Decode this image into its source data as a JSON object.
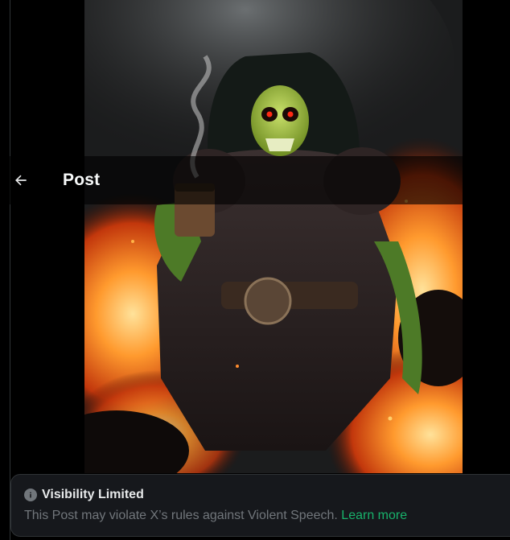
{
  "header": {
    "title": "Post",
    "back_icon": "arrow-left-icon"
  },
  "media": {
    "alt_subject": "skull-faced warrior holding coffee cup amid flames"
  },
  "notice": {
    "icon": "info-icon",
    "title": "Visibility Limited",
    "body": "This Post may violate X’s rules against Violent Speech.",
    "link_label": "Learn more",
    "link_color": "#18b26b"
  },
  "colors": {
    "background": "#000000",
    "notice_bg": "#16181c",
    "muted_text": "#71767b",
    "primary_text": "#e7e9ea"
  }
}
